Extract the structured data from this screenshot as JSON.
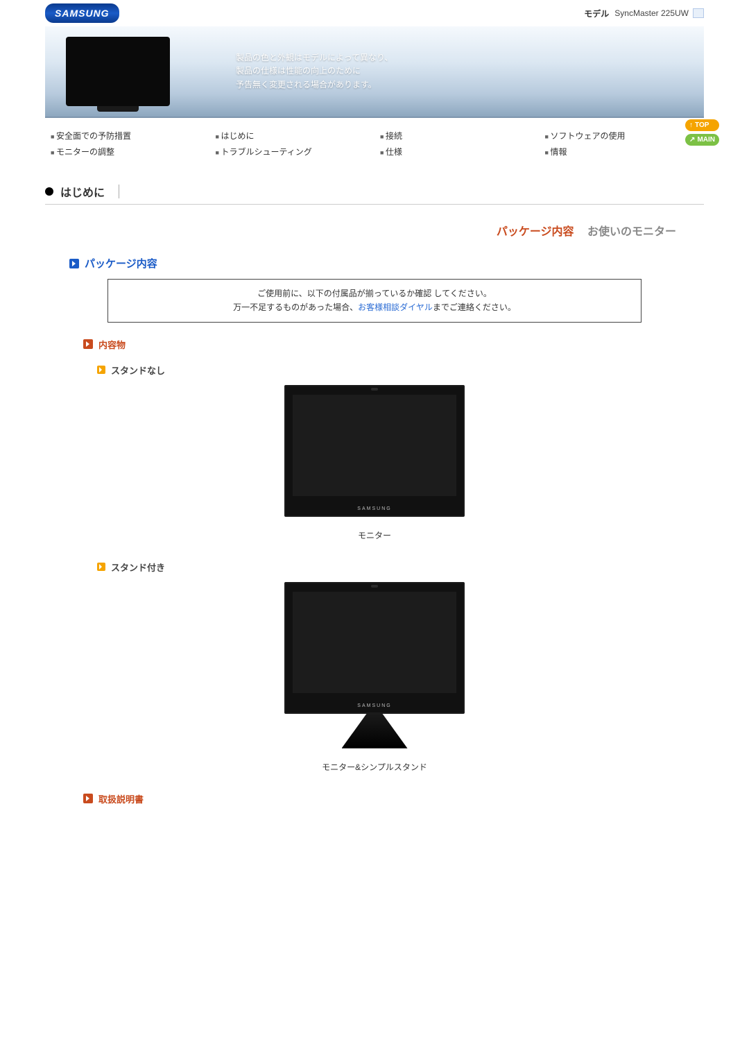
{
  "brand": "SAMSUNG",
  "model_label": "モデル",
  "model_value": "SyncMaster 225UW",
  "hero": {
    "line1": "製品の色と外観はモデルによって異なり、",
    "line2": "製品の仕様は性能の向上のために",
    "line3": "予告無く変更される場合があります。"
  },
  "nav": {
    "c1a": "安全面での予防措置",
    "c1b": "モニターの調整",
    "c2a": "はじめに",
    "c2b": "トラブルシューティング",
    "c3a": "接続",
    "c3b": "仕様",
    "c4a": "ソフトウェアの使用",
    "c4b": "情報"
  },
  "side": {
    "top": "TOP",
    "main": "MAIN"
  },
  "section_title": "はじめに",
  "tabs": {
    "active": "パッケージ内容",
    "inactive": "お使いのモニター"
  },
  "h_package": "パッケージ内容",
  "notice": {
    "line1": "ご使用前に、以下の付属品が揃っているか確認 してください。",
    "line2a": "万一不足するものがあった場合、",
    "line2_link": "お客様相談ダイヤル",
    "line2b": "までご連絡ください。"
  },
  "h_contents": "内容物",
  "h_nostand": "スタンドなし",
  "caption_monitor": "モニター",
  "h_withstand": "スタンド付き",
  "caption_monitor_stand": "モニター&シンプルスタンド",
  "h_manual": "取扱説明書",
  "monitor_brand": "SAMSUNG"
}
